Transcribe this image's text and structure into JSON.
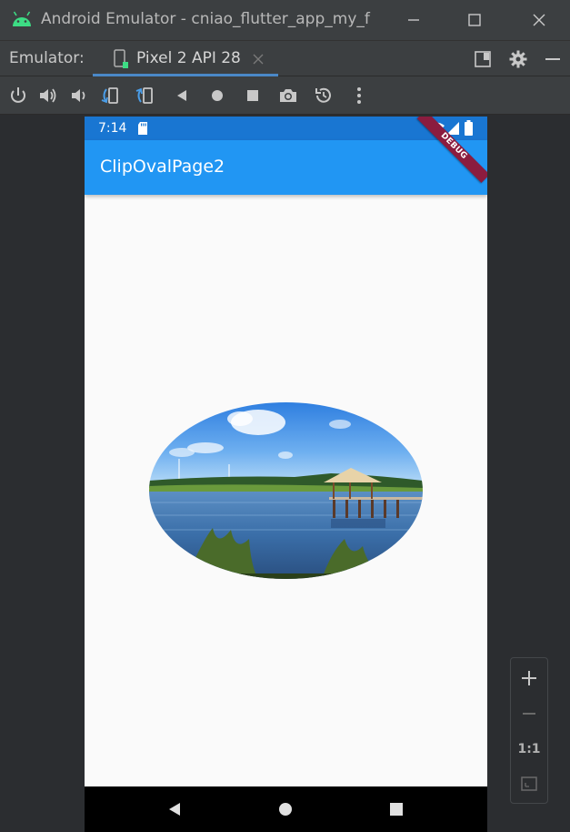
{
  "window": {
    "title": "Android Emulator - cniao_flutter_app_my_f",
    "icon": "android-icon"
  },
  "tabbar": {
    "label": "Emulator:",
    "tab_label": "Pixel 2 API 28"
  },
  "toolbar": {
    "icons": [
      "power-icon",
      "volume-up-icon",
      "volume-down-icon",
      "rotate-left-icon",
      "rotate-right-icon",
      "back-icon",
      "home-icon",
      "overview-icon",
      "camera-icon",
      "snapshot-icon",
      "more-icon"
    ]
  },
  "device": {
    "status_time": "7:14",
    "app_title": "ClipOvalPage2",
    "debug_banner": "DEBUG"
  },
  "zoom": {
    "one_to_one": "1:1"
  },
  "colors": {
    "status_bar": "#1976d2",
    "app_bar": "#2196f3",
    "ide_bg": "#3c3f41",
    "tab_accent": "#4a88c7"
  }
}
